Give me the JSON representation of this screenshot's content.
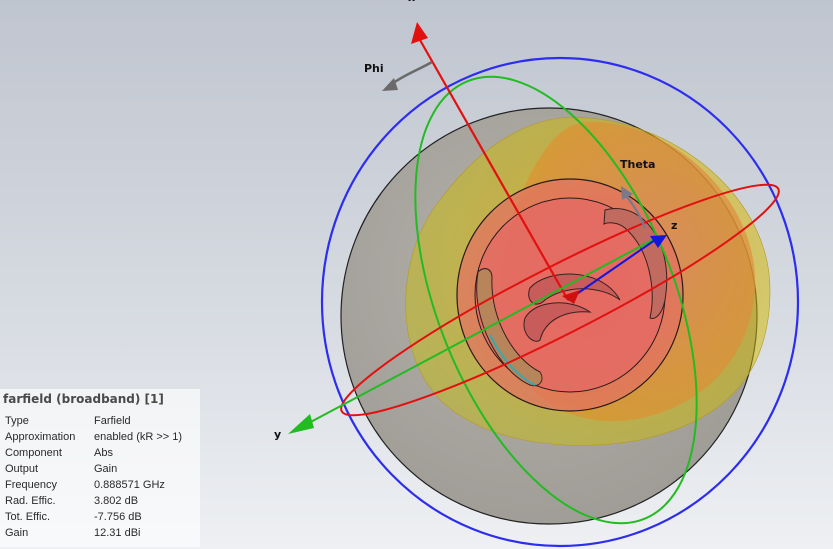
{
  "view": {
    "axis_labels": {
      "x": "x",
      "y": "y",
      "z": "z",
      "phi": "Phi",
      "theta": "Theta"
    },
    "colors": {
      "background_top": "#bfc5cf",
      "background_bottom": "#eef0f3",
      "x_axis": "#e31010",
      "y_axis": "#22bb22",
      "z_axis": "#1515e0",
      "phi_circle": "#2d2df0",
      "theta_circle": "#22bb22",
      "equator_circle": "#e31010",
      "substrate": "#a8a5a0",
      "pattern_outer": "#c8c000",
      "pattern_mid": "#e09030",
      "pattern_inner": "#e05050"
    },
    "icons": [
      "phi-rotation-arrow-icon",
      "theta-rotation-arrow-icon"
    ]
  },
  "info": {
    "title": "farfield (broadband) [1]",
    "rows": [
      {
        "key": "Type",
        "value": "Farfield"
      },
      {
        "key": "Approximation",
        "value": "enabled (kR >> 1)"
      },
      {
        "key": "Component",
        "value": "Abs"
      },
      {
        "key": "Output",
        "value": "Gain"
      },
      {
        "key": "Frequency",
        "value": "0.888571 GHz"
      },
      {
        "key": "Rad. Effic.",
        "value": "3.802 dB"
      },
      {
        "key": "Tot. Effic.",
        "value": "-7.756 dB"
      },
      {
        "key": "Gain",
        "value": "12.31 dBi"
      }
    ]
  }
}
